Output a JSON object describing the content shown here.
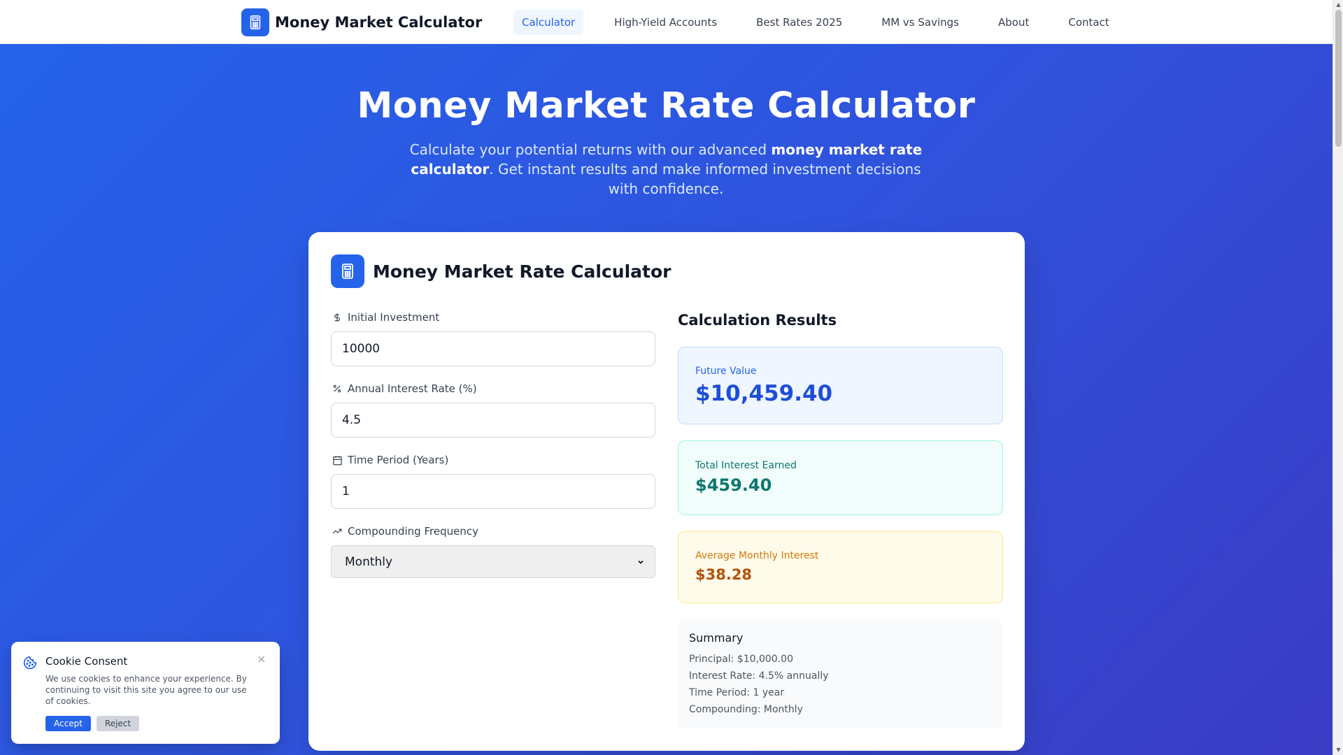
{
  "nav": {
    "brand": "Money Market Calculator",
    "brand_icon": "calculator-icon",
    "links": [
      "Calculator",
      "High-Yield Accounts",
      "Best Rates 2025",
      "MM vs Savings",
      "About",
      "Contact"
    ],
    "active": "Calculator"
  },
  "hero": {
    "title": "Money Market Rate Calculator",
    "sub_part1": "Calculate your potential returns with our advanced ",
    "sub_bold": "money market rate calculator",
    "sub_part2": ". Get instant results and make informed investment decisions with confidence."
  },
  "calculator": {
    "title": "Money Market Rate Calculator",
    "fields": {
      "initial": {
        "label": "Initial Investment",
        "value": "10000",
        "icon": "dollar-icon"
      },
      "rate": {
        "label": "Annual Interest Rate (%)",
        "value": "4.5",
        "icon": "percent-icon"
      },
      "years": {
        "label": "Time Period (Years)",
        "value": "1",
        "icon": "calendar-icon"
      },
      "frequency": {
        "label": "Compounding Frequency",
        "value": "Monthly",
        "icon": "trending-up-icon"
      }
    },
    "results": {
      "title": "Calculation Results",
      "future_label": "Future Value",
      "future_value": "$10,459.40",
      "interest_label": "Total Interest Earned",
      "interest_value": "$459.40",
      "monthly_label": "Average Monthly Interest",
      "monthly_value": "$38.28"
    },
    "summary": {
      "title": "Summary",
      "lines": [
        "Principal: $10,000.00",
        "Interest Rate: 4.5% annually",
        "Time Period: 1 year",
        "Compounding: Monthly"
      ]
    }
  },
  "cookie": {
    "title": "Cookie Consent",
    "text": "We use cookies to enhance your experience. By continuing to visit this site you agree to our use of cookies.",
    "accept": "Accept",
    "reject": "Reject",
    "close": "×"
  },
  "colors": {
    "primary": "#2563eb",
    "teal": "#0f766e",
    "amber": "#b45309"
  }
}
